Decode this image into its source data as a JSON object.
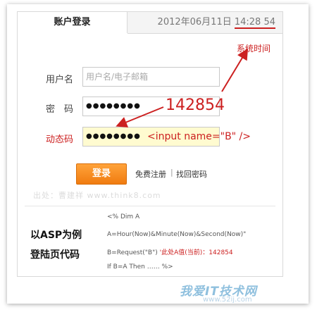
{
  "header": {
    "tab_label": "账户登录",
    "date": "2012年06月11日",
    "time": "14:28 54"
  },
  "annotations": {
    "system_time": "系统时间",
    "number": "142854",
    "input_tag": "<input name=\"B\" />"
  },
  "form": {
    "username_label": "用户名",
    "username_placeholder": "用户名/电子邮箱",
    "password_label": "密　码",
    "password_value": "●●●●●●●●",
    "dynamic_label": "动态码",
    "dynamic_value": "●●●●●●●●",
    "login_label": "登录",
    "register_label": "免费注册",
    "separator": "|",
    "forgot_label": "找回密码"
  },
  "watermark": "出处：曹建祥 www.think8.com",
  "asp": {
    "title_line1": "以ASP为例",
    "title_line2": "登陆页代码",
    "code_line1": "<% Dim A",
    "code_line2": "A=Hour(Now)&Minute(Now)&Second(Now)\"",
    "code_line3_main": "B=Request(\"B\")",
    "code_line3_note": "'此处A值(当前)：142854",
    "code_line4": "If B=A Then …… %>"
  },
  "branding": {
    "logo_text": "我爱IT技术网",
    "url": "www.52ij.com"
  },
  "colors": {
    "accent_red": "#cc2020",
    "button_orange": "#f5901e"
  }
}
